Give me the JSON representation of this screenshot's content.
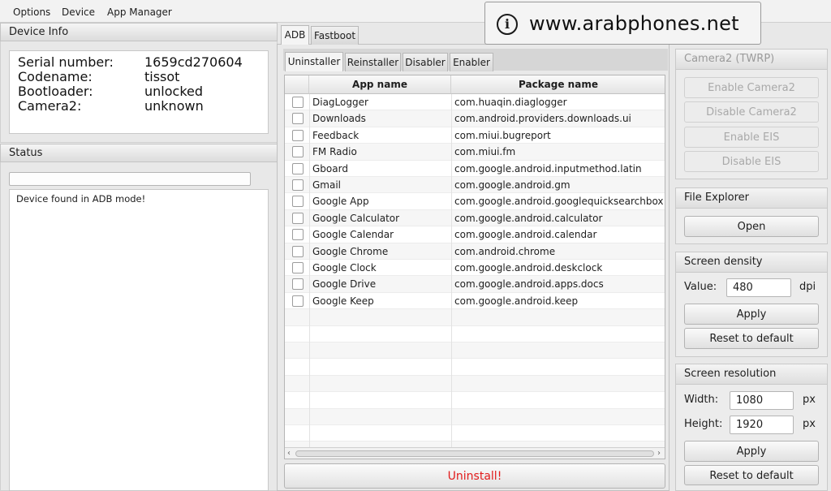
{
  "menu": [
    "Options",
    "Device",
    "App Manager"
  ],
  "watermark": {
    "icon": "info-icon",
    "glyph": "i",
    "text": "www.arabphones.net"
  },
  "device_info": {
    "title": "Device Info",
    "rows": [
      {
        "label": "Serial number:",
        "value": "1659cd270604"
      },
      {
        "label": "Codename:",
        "value": "tissot"
      },
      {
        "label": "Bootloader:",
        "value": "unlocked"
      },
      {
        "label": "Camera2:",
        "value": "unknown"
      }
    ]
  },
  "status": {
    "title": "Status",
    "progress": 0,
    "log": "Device found in ADB mode!"
  },
  "main_tabs": [
    {
      "label": "ADB",
      "active": true
    },
    {
      "label": "Fastboot",
      "active": false
    }
  ],
  "sub_tabs": [
    {
      "label": "Uninstaller",
      "active": true
    },
    {
      "label": "Reinstaller",
      "active": false
    },
    {
      "label": "Disabler",
      "active": false
    },
    {
      "label": "Enabler",
      "active": false
    }
  ],
  "table": {
    "headers": [
      "App name",
      "Package name"
    ],
    "rows": [
      {
        "app": "DiagLogger",
        "pkg": "com.huaqin.diaglogger",
        "checked": false
      },
      {
        "app": "Downloads",
        "pkg": "com.android.providers.downloads.ui",
        "checked": false
      },
      {
        "app": "Feedback",
        "pkg": "com.miui.bugreport",
        "checked": false
      },
      {
        "app": "FM Radio",
        "pkg": "com.miui.fm",
        "checked": false
      },
      {
        "app": "Gboard",
        "pkg": "com.google.android.inputmethod.latin",
        "checked": false
      },
      {
        "app": "Gmail",
        "pkg": "com.google.android.gm",
        "checked": false
      },
      {
        "app": "Google App",
        "pkg": "com.google.android.googlequicksearchbox",
        "checked": false
      },
      {
        "app": "Google Calculator",
        "pkg": "com.google.android.calculator",
        "checked": false
      },
      {
        "app": "Google Calendar",
        "pkg": "com.google.android.calendar",
        "checked": false
      },
      {
        "app": "Google Chrome",
        "pkg": "com.android.chrome",
        "checked": false
      },
      {
        "app": "Google Clock",
        "pkg": "com.google.android.deskclock",
        "checked": false
      },
      {
        "app": "Google Drive",
        "pkg": "com.google.android.apps.docs",
        "checked": false
      },
      {
        "app": "Google Keep",
        "pkg": "com.google.android.keep",
        "checked": false
      }
    ],
    "empty_rows": 9
  },
  "uninstall_label": "Uninstall!",
  "camera2": {
    "title": "Camera2 (TWRP)",
    "buttons": [
      "Enable Camera2",
      "Disable Camera2",
      "Enable EIS",
      "Disable EIS"
    ]
  },
  "file_explorer": {
    "title": "File Explorer",
    "open_label": "Open"
  },
  "density": {
    "title": "Screen density",
    "value_label": "Value:",
    "value": "480",
    "unit": "dpi",
    "apply": "Apply",
    "reset": "Reset to default"
  },
  "resolution": {
    "title": "Screen resolution",
    "width_label": "Width:",
    "width": "1080",
    "height_label": "Height:",
    "height": "1920",
    "unit": "px",
    "apply": "Apply",
    "reset": "Reset to default"
  },
  "colors": {
    "accent_red": "#e21b1b"
  }
}
